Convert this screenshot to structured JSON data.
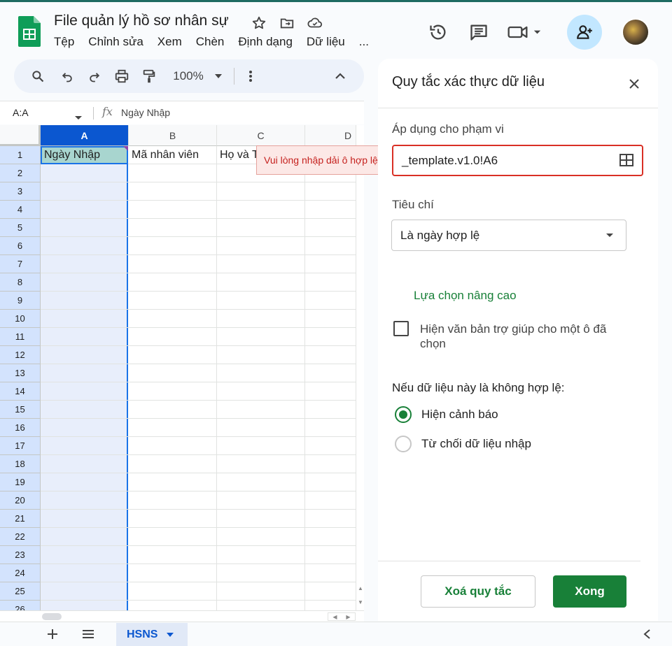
{
  "doc": {
    "title": "File quản lý hồ sơ nhân sự"
  },
  "menu": [
    "Tệp",
    "Chỉnh sửa",
    "Xem",
    "Chèn",
    "Định dạng",
    "Dữ liệu",
    "..."
  ],
  "toolbar": {
    "zoom": "100%"
  },
  "formula_bar": {
    "name_box": "A:A",
    "content": "Ngày Nhập"
  },
  "columns": [
    "A",
    "B",
    "C",
    "D"
  ],
  "rows": [
    "1",
    "2",
    "3",
    "4",
    "5",
    "6",
    "7",
    "8",
    "9",
    "10",
    "11",
    "12",
    "13",
    "14",
    "15",
    "16",
    "17",
    "18",
    "19",
    "20",
    "21",
    "22",
    "23",
    "24",
    "25",
    "26"
  ],
  "cells": {
    "A1": "Ngày Nhập",
    "B1": "Mã nhân viên",
    "C1": "Họ và T"
  },
  "tooltip": "Vui lòng nhập dải ô hợp lệ",
  "sheet_tab": "HSNS",
  "panel": {
    "title": "Quy tắc xác thực dữ liệu",
    "range_label": "Áp dụng cho phạm vi",
    "range_value": "_template.v1.0!A6",
    "criteria_label": "Tiêu chí",
    "criteria_value": "Là ngày hợp lệ",
    "advanced": "Lựa chọn nâng cao",
    "help_text_checkbox": "Hiện văn bản trợ giúp cho một ô đã chọn",
    "invalid_label": "Nếu dữ liệu này là không hợp lệ:",
    "option_warn": "Hiện cảnh báo",
    "option_reject": "Từ chối dữ liệu nhập",
    "remove_button": "Xoá quy tắc",
    "done_button": "Xong"
  },
  "colors": {
    "accent_green": "#188038",
    "selection_blue": "#1a73e8",
    "error_red": "#d93025"
  }
}
